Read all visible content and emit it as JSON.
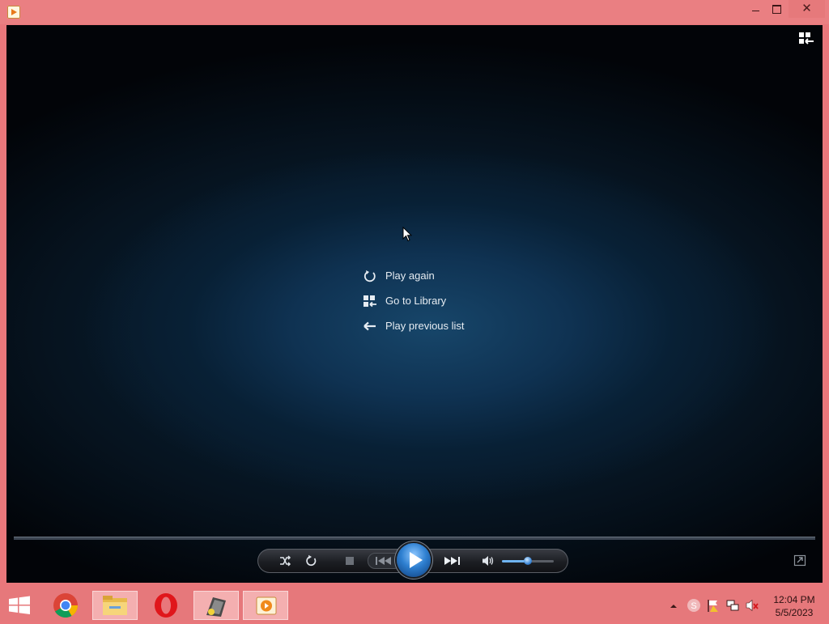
{
  "window": {
    "minimize_label": "–",
    "maximize_label": "☐",
    "close_label": "✕"
  },
  "player": {
    "end_menu": [
      {
        "label": "Play again",
        "icon": "replay-icon"
      },
      {
        "label": "Go to Library",
        "icon": "library-icon"
      },
      {
        "label": "Play previous list",
        "icon": "back-arrow-icon"
      }
    ],
    "volume_level": 0.5
  },
  "taskbar": {
    "apps": [
      "start",
      "chrome",
      "file-explorer",
      "opera",
      "media-app",
      "windows-media-player"
    ],
    "clock_time": "12:04 PM",
    "clock_date": "5/5/2023"
  },
  "colors": {
    "frame": "#e9777b",
    "player_bg": "#0b2740",
    "accent": "#2e7fd0"
  }
}
